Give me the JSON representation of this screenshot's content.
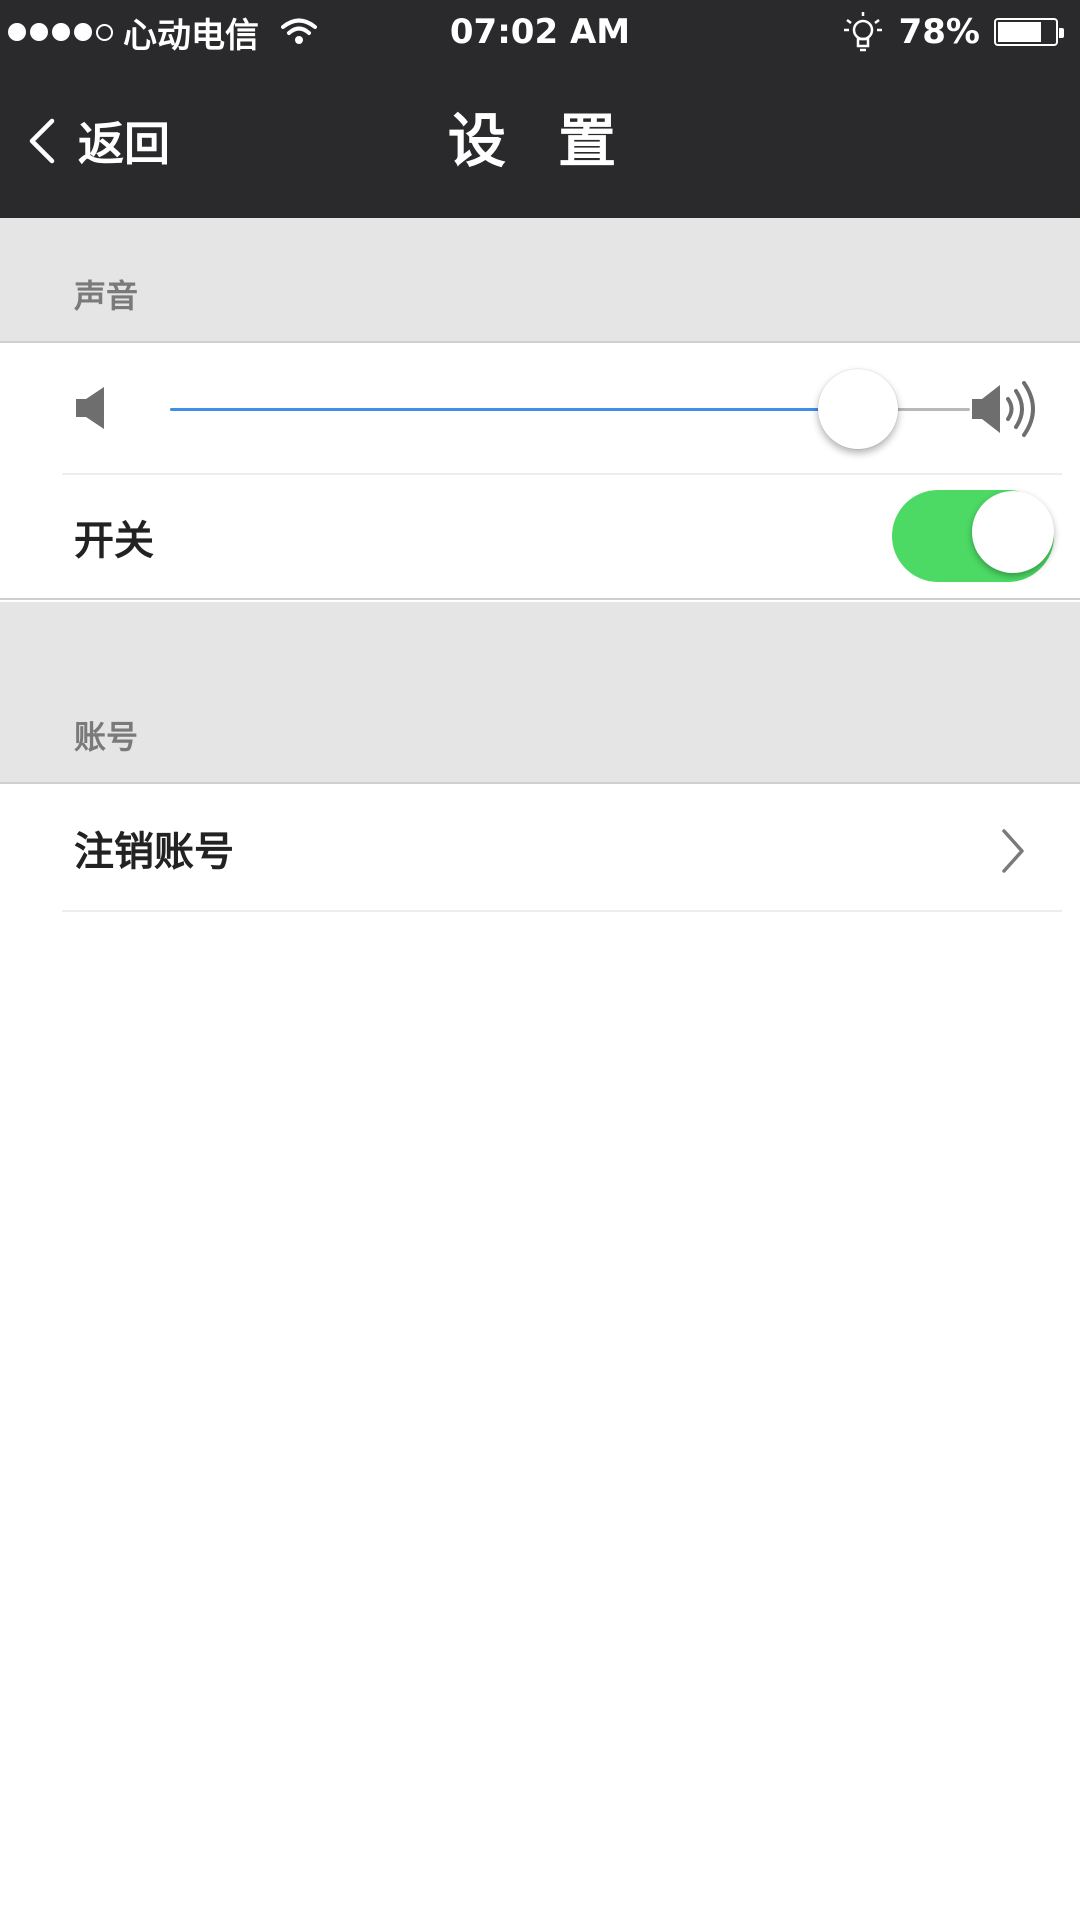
{
  "status_bar": {
    "signal_dots_filled": 4,
    "signal_dots_total": 5,
    "carrier": "心动电信",
    "time": "07:02 AM",
    "battery_percent": "78%",
    "battery_level": 0.78,
    "icons": [
      "wifi-icon",
      "bulb-icon",
      "battery-icon"
    ]
  },
  "nav": {
    "back_label": "返回",
    "title": "设 置"
  },
  "sections": {
    "sound": {
      "header": "声音",
      "volume_level": 0.86,
      "switch_label": "开关",
      "switch_on": true
    },
    "account": {
      "header": "账号",
      "logout_label": "注销账号"
    }
  },
  "colors": {
    "nav_background": "#2a2a2c",
    "section_background": "#e5e5e5",
    "slider_fill": "#3d8fe8",
    "toggle_on": "#4cd964"
  }
}
